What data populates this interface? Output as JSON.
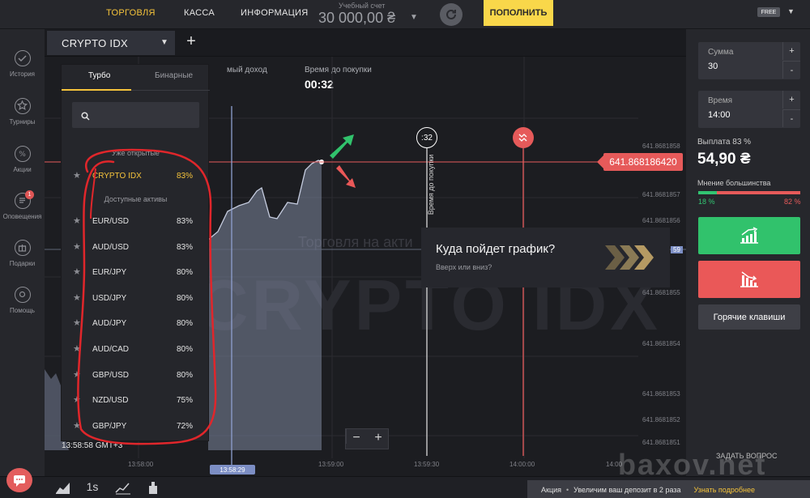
{
  "topnav": {
    "items": [
      {
        "label": "ТОРГОВЛЯ",
        "active": true
      },
      {
        "label": "КАССА",
        "active": false
      },
      {
        "label": "ИНФОРМАЦИЯ",
        "active": false
      }
    ],
    "account_label": "Учебный счет",
    "account_value": "30 000,00 ₴",
    "deposit_label": "ПОПОЛНИТЬ",
    "plan_badge": "FREE"
  },
  "sidebar": {
    "items": [
      {
        "label": "История",
        "icon": "history-icon"
      },
      {
        "label": "Турниры",
        "icon": "trophy-icon"
      },
      {
        "label": "Акции",
        "icon": "percent-icon"
      },
      {
        "label": "Оповещения",
        "icon": "notification-icon",
        "badge": "1"
      },
      {
        "label": "Подарки",
        "icon": "gift-icon"
      },
      {
        "label": "Помощь",
        "icon": "help-icon"
      }
    ]
  },
  "chart_header": {
    "asset_tab": "CRYPTO IDX",
    "profit_label": "мый доход",
    "buy_time_label": "Время до покупки",
    "buy_time_value": "00:32"
  },
  "asset_panel": {
    "tabs": [
      {
        "label": "Турбо",
        "active": true
      },
      {
        "label": "Бинарные",
        "active": false
      }
    ],
    "search_value": "",
    "section_open": "Уже открытые",
    "section_available": "Доступные активы",
    "open_assets": [
      {
        "name": "CRYPTO IDX",
        "payout": "83%"
      }
    ],
    "available_assets": [
      {
        "name": "EUR/USD",
        "payout": "83%"
      },
      {
        "name": "AUD/USD",
        "payout": "83%"
      },
      {
        "name": "EUR/JPY",
        "payout": "80%"
      },
      {
        "name": "USD/JPY",
        "payout": "80%"
      },
      {
        "name": "AUD/JPY",
        "payout": "80%"
      },
      {
        "name": "AUD/CAD",
        "payout": "80%"
      },
      {
        "name": "GBP/USD",
        "payout": "80%"
      },
      {
        "name": "NZD/USD",
        "payout": "75%"
      },
      {
        "name": "GBP/JPY",
        "payout": "72%"
      }
    ]
  },
  "chart": {
    "watermark": "CRYPTO IDX",
    "watermark_sub": "Торговля на акти",
    "current_price": "641.868186420",
    "y_ticks": [
      "641.8681858",
      "641.8681857",
      "641.8681856",
      "641.8681855",
      "641.8681854",
      "641.8681853",
      "641.8681852",
      "641.8681851"
    ],
    "right_edge_tag": "59",
    "timer_label": ":32",
    "buy_time_vertical": "Время до покупки",
    "clock": "13:58:58 GMT+3",
    "x_ticks": [
      "13:58:00",
      "13:59:00",
      "13:59:30",
      "14:00:00",
      "14:00"
    ],
    "time_marker": "13:58:29",
    "prompt_title": "Куда пойдет график?",
    "prompt_sub": "Вверх или вниз?"
  },
  "trade_panel": {
    "amount_label": "Сумма",
    "amount_value": "30",
    "time_label": "Время",
    "time_value": "14:00",
    "payout_label": "Выплата 83 %",
    "payout_value": "54,90 ₴",
    "majority_label": "Мнение большинства",
    "majority_up": "18 %",
    "majority_down": "82 %",
    "majority_up_fraction": 0.18,
    "hotkeys_label": "Горячие клавиши",
    "ask_label": "ЗАДАТЬ ВОПРОС"
  },
  "bottom": {
    "expiry_label": "1s",
    "promo_prefix": "Акция",
    "promo_text": "Увеличим ваш депозит в 2 раза",
    "promo_link": "Узнать подробнее",
    "site_watermark": "baxov.net"
  },
  "colors": {
    "accent": "#f5c33b",
    "up": "#31c26c",
    "down": "#ea5858",
    "background": "#1c1d21"
  }
}
